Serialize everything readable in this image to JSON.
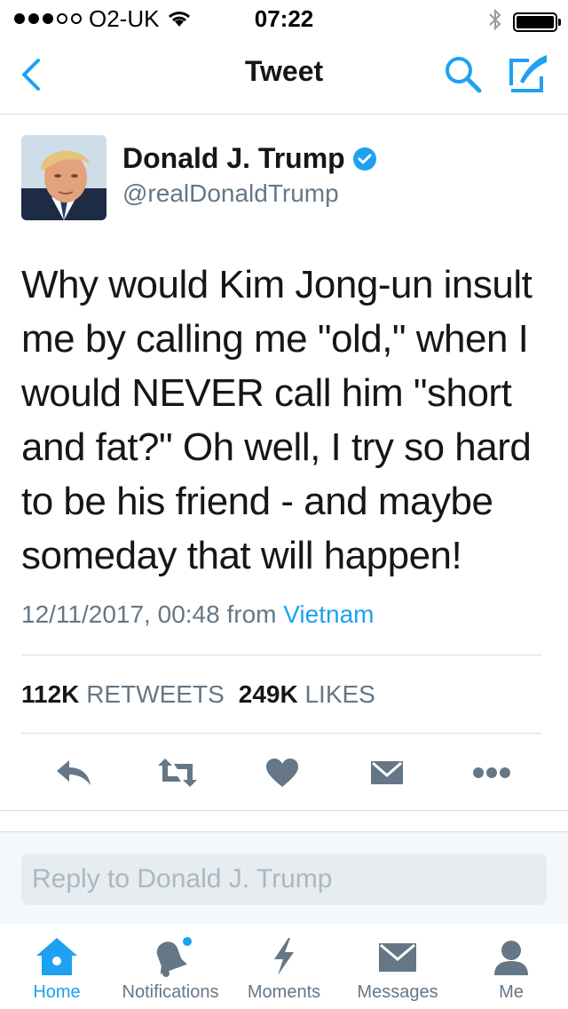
{
  "status_bar": {
    "carrier": "O2-UK",
    "time": "07:22",
    "signal_bars_filled": 3,
    "signal_bars_total": 5,
    "battery_level": 1.0
  },
  "nav": {
    "title": "Tweet",
    "back_icon": "chevron-left-icon",
    "search_icon": "search-icon",
    "compose_icon": "compose-tweet-icon"
  },
  "tweet": {
    "author_name": "Donald J. Trump",
    "verified": true,
    "handle": "@realDonaldTrump",
    "text": "Why would Kim Jong-un insult me by calling me \"old,\" when I would NEVER call him \"short and fat?\" Oh well, I try so hard to be his friend - and maybe someday that will happen!",
    "timestamp": "12/11/2017, 00:48",
    "from_label": "from",
    "location": "Vietnam",
    "retweets_count": "112K",
    "retweets_label": "RETWEETS",
    "likes_count": "249K",
    "likes_label": "LIKES"
  },
  "actions": [
    "reply-icon",
    "retweet-icon",
    "like-icon",
    "direct-message-icon",
    "more-icon"
  ],
  "reply": {
    "placeholder": "Reply to Donald J. Trump"
  },
  "tab_bar": {
    "items": [
      {
        "label": "Home",
        "icon": "home-icon",
        "active": true
      },
      {
        "label": "Notifications",
        "icon": "notifications-icon",
        "active": false
      },
      {
        "label": "Moments",
        "icon": "moments-icon",
        "active": false
      },
      {
        "label": "Messages",
        "icon": "messages-icon",
        "active": false
      },
      {
        "label": "Me",
        "icon": "me-icon",
        "active": false
      }
    ]
  },
  "colors": {
    "accent": "#1da1f2",
    "text": "#14171a",
    "secondary_text": "#657786",
    "icon_gray": "#657786"
  }
}
